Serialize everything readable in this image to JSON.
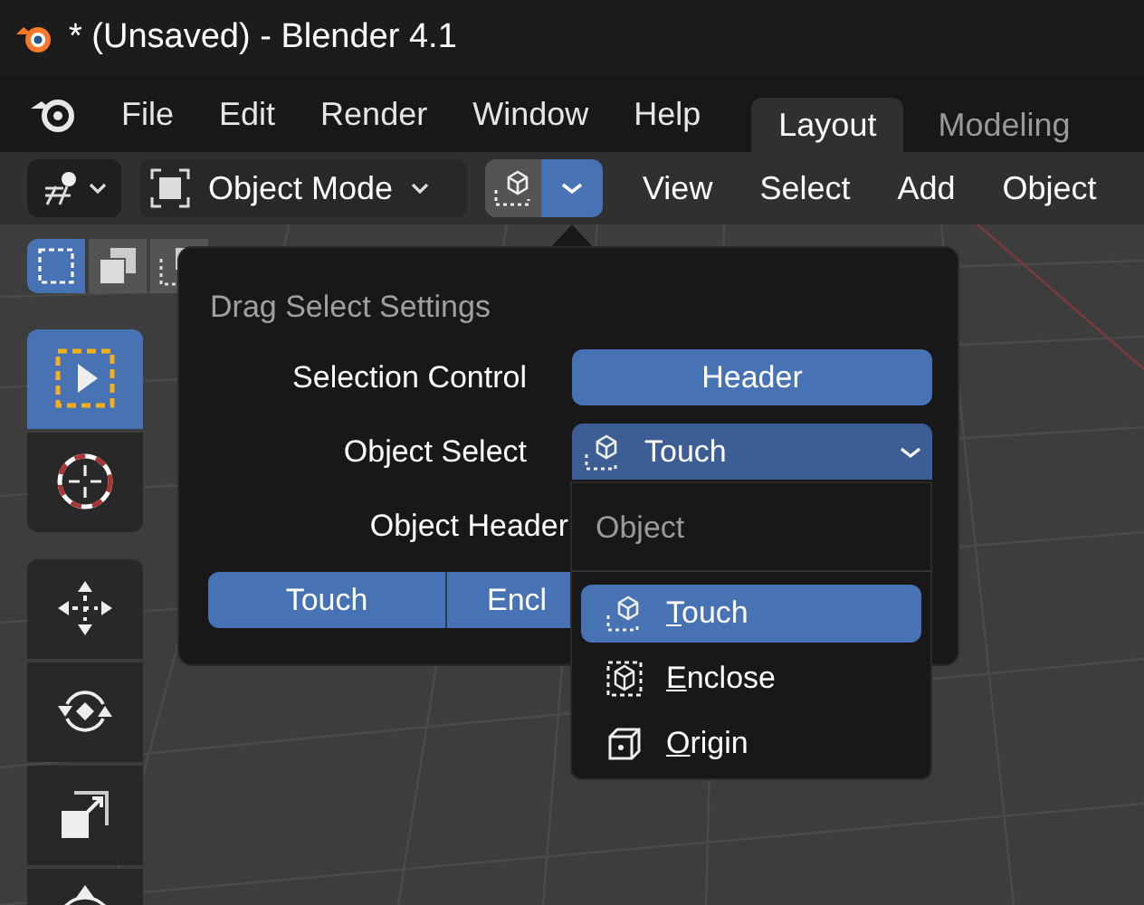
{
  "window": {
    "title": "* (Unsaved) - Blender 4.1"
  },
  "menu": [
    "File",
    "Edit",
    "Render",
    "Window",
    "Help"
  ],
  "workspace_tabs": [
    {
      "label": "Layout",
      "selected": true
    },
    {
      "label": "Modeling",
      "selected": false
    }
  ],
  "header": {
    "mode": "Object Mode",
    "menus": [
      "View",
      "Select",
      "Add",
      "Object"
    ]
  },
  "select_modes": [
    {
      "kind": "set",
      "selected": true
    },
    {
      "kind": "extend",
      "selected": false
    },
    {
      "kind": "subtract",
      "selected": false
    }
  ],
  "tool_groups": [
    [
      {
        "kind": "select_box",
        "selected": true
      },
      {
        "kind": "cursor",
        "selected": false
      }
    ],
    [
      {
        "kind": "move",
        "selected": false
      },
      {
        "kind": "rotate",
        "selected": false
      },
      {
        "kind": "scale",
        "selected": false
      },
      {
        "kind": "transform",
        "selected": false
      }
    ]
  ],
  "popover": {
    "title": "Drag Select Settings",
    "rows": [
      {
        "label": "Selection Control",
        "value": "Header"
      },
      {
        "label": "Object Select",
        "value": "Touch"
      },
      {
        "label": "Object Header"
      }
    ],
    "segments": [
      {
        "label": "Touch",
        "selected": true
      },
      {
        "label": "Encl",
        "selected": true
      }
    ]
  },
  "dropdown": {
    "heading": "Object",
    "options": [
      {
        "label": "Touch",
        "kind": "touch",
        "selected": true
      },
      {
        "label": "Enclose",
        "kind": "enclose",
        "selected": false
      },
      {
        "label": "Origin",
        "kind": "origin",
        "selected": false
      }
    ]
  }
}
